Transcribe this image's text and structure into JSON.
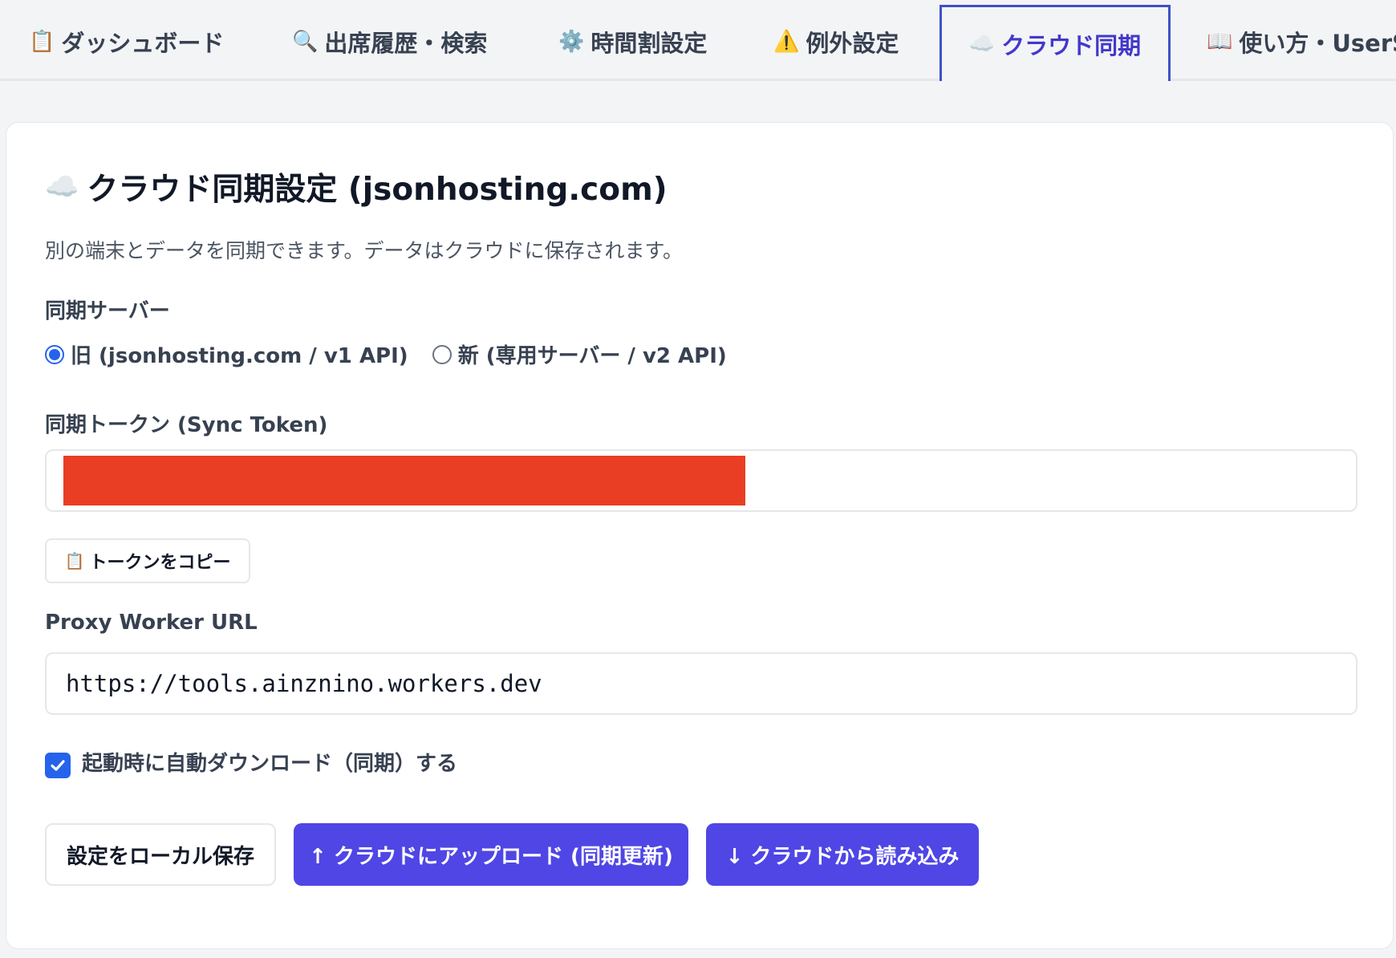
{
  "colors": {
    "accent": "#4f46e5",
    "tab_active": "#4338ca",
    "radio_checkbox": "#2563eb",
    "redaction": "#e93e23"
  },
  "tabs": [
    {
      "icon": "📋",
      "icon_name": "clipboard-icon",
      "label": "ダッシュボード"
    },
    {
      "icon": "🔍",
      "icon_name": "magnifier-icon",
      "label": "出席履歴・検索"
    },
    {
      "icon": "⚙️",
      "icon_name": "gear-icon",
      "label": "時間割設定"
    },
    {
      "icon": "⚠️",
      "icon_name": "warning-icon",
      "label": "例外設定"
    },
    {
      "icon": "☁️",
      "icon_name": "cloud-icon",
      "label": "クラウド同期",
      "active": true
    },
    {
      "icon": "📖",
      "icon_name": "book-icon",
      "label": "使い方・UserS"
    }
  ],
  "card": {
    "title_icon": "☁️",
    "title": "クラウド同期設定 (jsonhosting.com)",
    "description": "別の端末とデータを同期できます。データはクラウドに保存されます。",
    "server": {
      "label": "同期サーバー",
      "options": [
        {
          "label": "旧 (jsonhosting.com / v1 API)",
          "checked": true
        },
        {
          "label": "新 (専用サーバー / v2 API)",
          "checked": false
        }
      ]
    },
    "token": {
      "label": "同期トークン (Sync Token)",
      "value": ""
    },
    "copy_button": {
      "icon": "📋",
      "label": "トークンをコピー"
    },
    "proxy": {
      "label": "Proxy Worker URL",
      "value": "https://tools.ainznino.workers.dev"
    },
    "autosync": {
      "label": "起動時に自動ダウンロード（同期）する",
      "checked": true
    },
    "buttons": {
      "save_local": "設定をローカル保存",
      "upload": "↑ クラウドにアップロード (同期更新)",
      "download": "↓ クラウドから読み込み"
    }
  }
}
